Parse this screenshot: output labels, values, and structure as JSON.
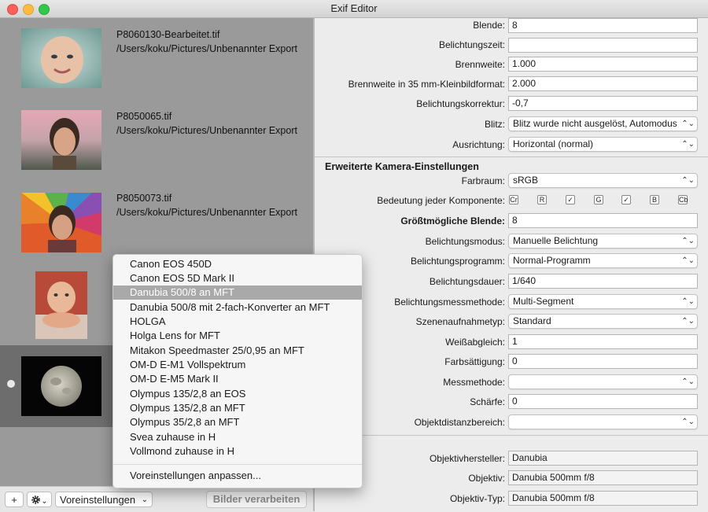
{
  "window": {
    "title": "Exif Editor"
  },
  "files": [
    {
      "name": "P8060130-Bearbeitet.tif",
      "path": "/Users/koku/Pictures/Unbenannter Export"
    },
    {
      "name": "P8050065.tif",
      "path": "/Users/koku/Pictures/Unbenannter Export"
    },
    {
      "name": "P8050073.tif",
      "path": "/Users/koku/Pictures/Unbenannter Export"
    }
  ],
  "fields": {
    "blende": {
      "label": "Blende:",
      "value": "8"
    },
    "belichtungszeit": {
      "label": "Belichtungszeit:",
      "value": ""
    },
    "brennweite": {
      "label": "Brennweite:",
      "value": "1.000"
    },
    "brennweite35": {
      "label": "Brennweite in 35 mm-Kleinbildformat:",
      "value": "2.000"
    },
    "belichtungskorrektur": {
      "label": "Belichtungskorrektur:",
      "value": "-0,7"
    },
    "blitz": {
      "label": "Blitz:",
      "value": "Blitz wurde nicht ausgelöst, Automodus"
    },
    "ausrichtung": {
      "label": "Ausrichtung:",
      "value": "Horizontal (normal)"
    }
  },
  "extended": {
    "title": "Erweiterte Kamera-Einstellungen",
    "farbraum": {
      "label": "Farbraum:",
      "value": "sRGB"
    },
    "komponente": {
      "label": "Bedeutung jeder Komponente:",
      "letters": [
        "Cr",
        "R",
        "",
        "G",
        "",
        "B",
        "Cb"
      ]
    },
    "groesstmoegliche": {
      "label": "Größtmögliche Blende:",
      "value": "8"
    },
    "belichtungsmodus": {
      "label": "Belichtungsmodus:",
      "value": "Manuelle Belichtung"
    },
    "belichtungsprogramm": {
      "label": "Belichtungsprogramm:",
      "value": "Normal-Programm"
    },
    "belichtungsdauer": {
      "label": "Belichtungsdauer:",
      "value": "1/640"
    },
    "messmethode_bel": {
      "label": "Belichtungsmessmethode:",
      "value": "Multi-Segment"
    },
    "szenen": {
      "label": "Szenenaufnahmetyp:",
      "value": "Standard"
    },
    "weiss": {
      "label": "Weißabgleich:",
      "value": "1"
    },
    "farbsaettigung": {
      "label": "Farbsättigung:",
      "value": "0"
    },
    "messmethode": {
      "label": "Messmethode:",
      "value": ""
    },
    "schaerfe": {
      "label": "Schärfe:",
      "value": "0"
    },
    "objektdistanz": {
      "label": "Objektdistanzbereich:",
      "value": ""
    }
  },
  "lens": {
    "hersteller": {
      "label": "Objektivhersteller:",
      "value": "Danubia"
    },
    "objektiv": {
      "label": "Objektiv:",
      "value": "Danubia 500mm f/8"
    },
    "typ": {
      "label": "Objektiv-Typ:",
      "value": "Danubia 500mm f/8"
    }
  },
  "menu": {
    "items": [
      "Canon EOS 450D",
      "Canon EOS 5D Mark II",
      "Danubia 500/8 an MFT",
      "Danubia 500/8 mit 2-fach-Konverter an MFT",
      "HOLGA",
      "Holga Lens for MFT",
      "Mitakon Speedmaster 25/0,95 an MFT",
      "OM-D E-M1 Vollspektrum",
      "OM-D E-M5 Mark II",
      "Olympus 135/2,8 an EOS",
      "Olympus 135/2,8 an MFT",
      "Olympus 35/2,8 an MFT",
      "Svea zuhause in H",
      "Vollmond zuhause in H"
    ],
    "highlighted_index": 2,
    "footer": "Voreinstellungen anpassen..."
  },
  "toolbar": {
    "add": "+",
    "gear_chevron": "⌄",
    "presets": "Voreinstellungen",
    "process": "Bilder verarbeiten"
  },
  "icons": {
    "add": "plus-icon",
    "gear": "gear-icon",
    "chevron": "chevron-down-icon",
    "popup": "up-down-chevron-icon"
  }
}
